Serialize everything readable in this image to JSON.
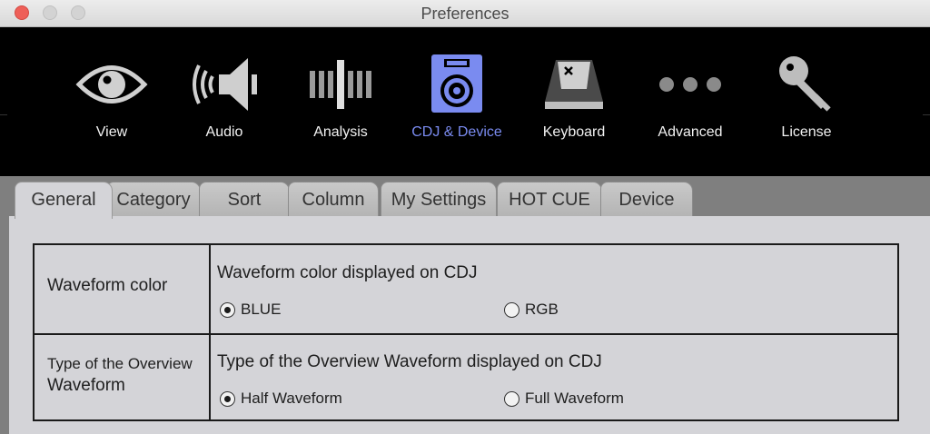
{
  "window": {
    "title": "Preferences"
  },
  "toolbar": {
    "items": [
      {
        "label": "View",
        "icon": "eye-icon"
      },
      {
        "label": "Audio",
        "icon": "speaker-icon"
      },
      {
        "label": "Analysis",
        "icon": "waveform-bars-icon"
      },
      {
        "label": "CDJ & Device",
        "icon": "cdj-device-icon",
        "active": true
      },
      {
        "label": "Keyboard",
        "icon": "keycap-icon"
      },
      {
        "label": "Advanced",
        "icon": "three-dots-icon"
      },
      {
        "label": "License",
        "icon": "key-icon"
      }
    ],
    "active_color": "#7a8bf0"
  },
  "tabs": [
    {
      "label": "General",
      "active": true
    },
    {
      "label": "Category"
    },
    {
      "label": "Sort"
    },
    {
      "label": "Column"
    },
    {
      "label": "My Settings"
    },
    {
      "label": "HOT CUE"
    },
    {
      "label": "Device"
    }
  ],
  "settings": {
    "waveform_color": {
      "label": "Waveform color",
      "description": "Waveform color displayed on CDJ",
      "options": [
        {
          "label": "BLUE",
          "selected": true
        },
        {
          "label": "RGB",
          "selected": false
        }
      ]
    },
    "overview_waveform": {
      "label_line1": "Type of the Overview",
      "label_line2": "Waveform",
      "description": "Type of the Overview Waveform displayed on CDJ",
      "options": [
        {
          "label": "Half Waveform",
          "selected": true
        },
        {
          "label": "Full Waveform",
          "selected": false
        }
      ]
    }
  }
}
